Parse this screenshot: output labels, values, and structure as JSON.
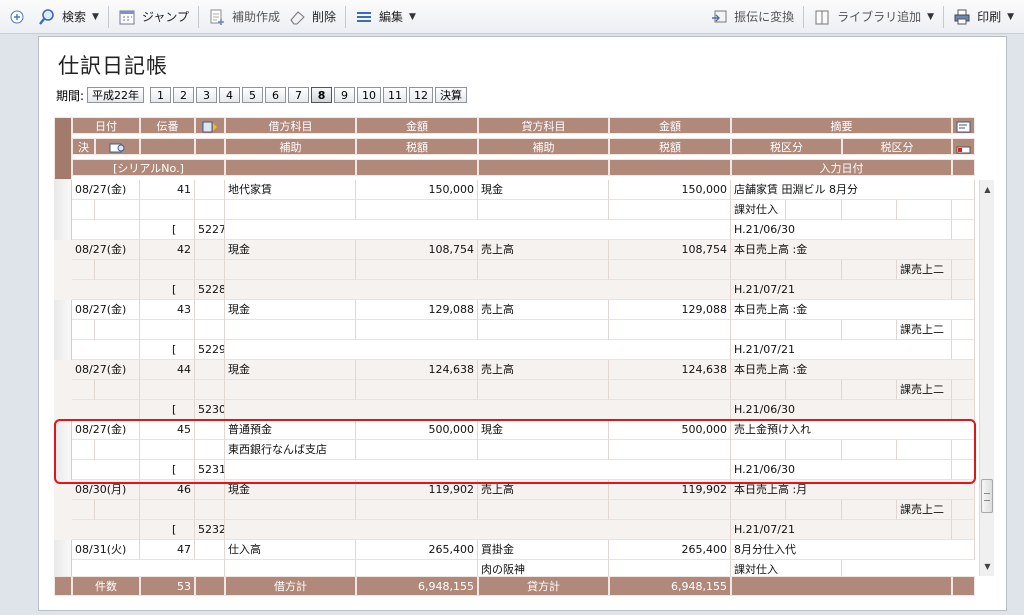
{
  "toolbar": {
    "search": "検索",
    "jump": "ジャンプ",
    "aux_create": "補助作成",
    "delete": "削除",
    "edit": "編集",
    "convert_transfer": "振伝に変換",
    "add_library": "ライブラリ追加",
    "print": "印刷"
  },
  "page": {
    "title": "仕訳日記帳"
  },
  "period": {
    "label": "期間:",
    "era": "平成22年",
    "months": [
      "1",
      "2",
      "3",
      "4",
      "5",
      "6",
      "7",
      "8",
      "9",
      "10",
      "11",
      "12"
    ],
    "selected": "8",
    "settle": "決算"
  },
  "headers": {
    "r1": {
      "date": "日付",
      "slip": "伝番",
      "debit": "借方科目",
      "amount1": "金額",
      "credit": "貸方科目",
      "amount2": "金額",
      "summary": "摘要"
    },
    "r2": {
      "settle": "決",
      "aux1": "補助",
      "tax1": "税額",
      "aux2": "補助",
      "tax2": "税額",
      "taxcat1": "税区分",
      "taxcat2": "税区分"
    },
    "r3": {
      "serial": "[シリアルNo.]",
      "input_date": "入力日付"
    }
  },
  "records": [
    {
      "date": "08/27(金)",
      "no": "41",
      "debit": "地代家賃",
      "amount_dr": "150,000",
      "credit": "現金",
      "amount_cr": "150,000",
      "summary": "店舗家賃 田淵ビル 8月分",
      "debit_sub": "",
      "tax_a": "課対仕入",
      "tax_b": "",
      "serial_open": "[",
      "serial": "5227]",
      "input_date": "H.21/06/30"
    },
    {
      "date": "08/27(金)",
      "no": "42",
      "debit": "現金",
      "amount_dr": "108,754",
      "credit": "売上高",
      "amount_cr": "108,754",
      "summary": "本日売上高 :金",
      "debit_sub": "",
      "tax_a": "",
      "tax_b": "課売上二",
      "serial_open": "[",
      "serial": "5228]",
      "input_date": "H.21/07/21"
    },
    {
      "date": "08/27(金)",
      "no": "43",
      "debit": "現金",
      "amount_dr": "129,088",
      "credit": "売上高",
      "amount_cr": "129,088",
      "summary": "本日売上高 :金",
      "debit_sub": "",
      "tax_a": "",
      "tax_b": "課売上二",
      "serial_open": "[",
      "serial": "5229]",
      "input_date": "H.21/07/21"
    },
    {
      "date": "08/27(金)",
      "no": "44",
      "debit": "現金",
      "amount_dr": "124,638",
      "credit": "売上高",
      "amount_cr": "124,638",
      "summary": "本日売上高 :金",
      "debit_sub": "",
      "tax_a": "",
      "tax_b": "課売上二",
      "serial_open": "[",
      "serial": "5230]",
      "input_date": "H.21/06/30"
    },
    {
      "date": "08/27(金)",
      "no": "45",
      "debit": "普通預金",
      "amount_dr": "500,000",
      "credit": "現金",
      "amount_cr": "500,000",
      "summary": "売上金預け入れ",
      "debit_sub": "東西銀行なんば支店",
      "tax_a": "",
      "tax_b": "",
      "serial_open": "[",
      "serial": "5231]",
      "input_date": "H.21/06/30"
    },
    {
      "date": "08/30(月)",
      "no": "46",
      "debit": "現金",
      "amount_dr": "119,902",
      "credit": "売上高",
      "amount_cr": "119,902",
      "summary": "本日売上高 :月",
      "debit_sub": "",
      "tax_a": "",
      "tax_b": "課売上二",
      "serial_open": "[",
      "serial": "5232]",
      "input_date": "H.21/07/21"
    },
    {
      "date": "08/31(火)",
      "no": "47",
      "debit": "仕入高",
      "amount_dr": "265,400",
      "credit": "買掛金",
      "amount_cr": "265,400",
      "summary": "8月分仕入代",
      "debit_sub": "",
      "credit_sub": "肉の阪神",
      "tax_a": "課対仕入",
      "tax_b": "",
      "serial_open": "",
      "serial": "",
      "input_date": ""
    }
  ],
  "footer": {
    "count_label": "件数",
    "count": "53",
    "debit_total_label": "借方計",
    "debit_total": "6,948,155",
    "credit_total_label": "貸方計",
    "credit_total": "6,948,155"
  }
}
